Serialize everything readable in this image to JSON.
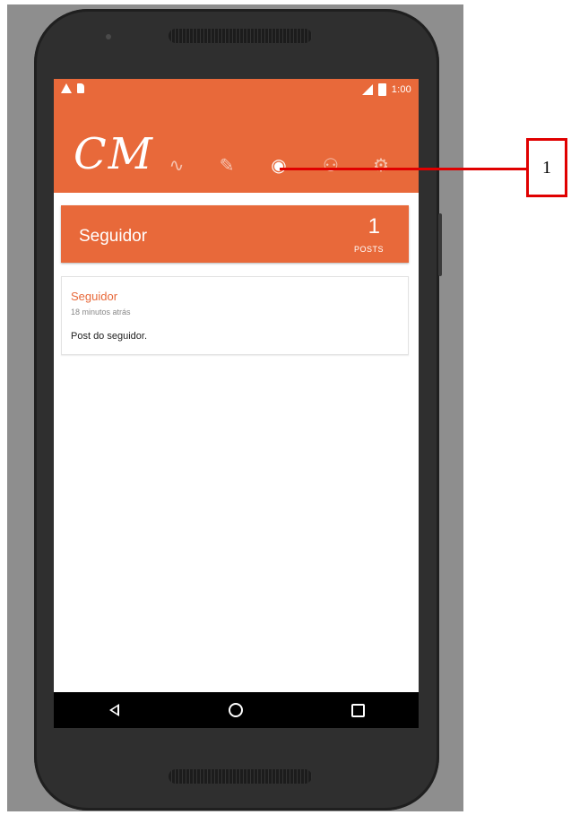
{
  "status_bar": {
    "time": "1:00"
  },
  "app": {
    "logo": "CM",
    "tabs": [
      {
        "name": "activity",
        "icon": "activity-icon",
        "glyph": "∿"
      },
      {
        "name": "write",
        "icon": "pencil-icon",
        "glyph": "✎"
      },
      {
        "name": "profile",
        "icon": "account-icon",
        "glyph": "◉",
        "active": true
      },
      {
        "name": "followers",
        "icon": "people-icon",
        "glyph": "⚇"
      },
      {
        "name": "settings",
        "icon": "gear-icon",
        "glyph": "⚙"
      }
    ],
    "accent_color": "#e8693a"
  },
  "profile_header": {
    "title": "Seguidor",
    "post_count": "1",
    "post_count_label": "POSTS"
  },
  "posts": [
    {
      "author": "Seguidor",
      "time": "18 minutos atrás",
      "text": "Post do seguidor."
    }
  ],
  "annotation": {
    "label": "1",
    "color": "#e00000"
  }
}
